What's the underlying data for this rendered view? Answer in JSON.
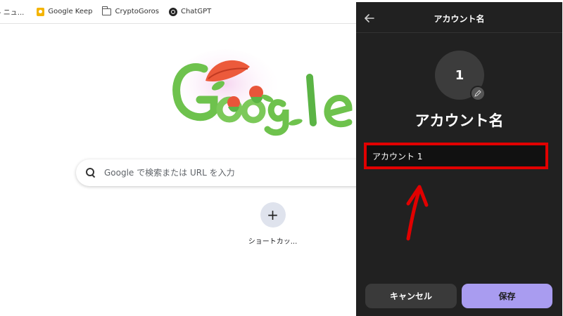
{
  "bookmarks_bar": {
    "items": [
      {
        "label": "- ニュ...",
        "icon": ""
      },
      {
        "label": "Google Keep",
        "icon": "google-keep-icon"
      },
      {
        "label": "CryptoGoros",
        "icon": "folder-icon"
      },
      {
        "label": "ChatGPT",
        "icon": "chatgpt-icon"
      }
    ]
  },
  "new_tab": {
    "search": {
      "placeholder": "Google で検索または URL を入力",
      "icon": "search-icon"
    },
    "shortcut": {
      "icon": "plus-icon",
      "glyph": "+",
      "label": "ショートカッ..."
    },
    "doodle": {
      "description_icon": "google-doodle"
    }
  },
  "account_panel": {
    "header": {
      "title": "アカウント名",
      "back_icon": "arrow-left-icon"
    },
    "avatar": {
      "text": "1",
      "edit_icon": "pencil-icon"
    },
    "display_name": "アカウント名",
    "name_field": {
      "value": "アカウント 1"
    },
    "annotation": {
      "highlight_color": "#e10000",
      "arrow": "red-arrow-up-icon"
    },
    "buttons": {
      "cancel": "キャンセル",
      "save": "保存"
    },
    "colors": {
      "background": "#212121",
      "save_button": "#a99cf0",
      "cancel_button": "#3a3a3a"
    }
  }
}
